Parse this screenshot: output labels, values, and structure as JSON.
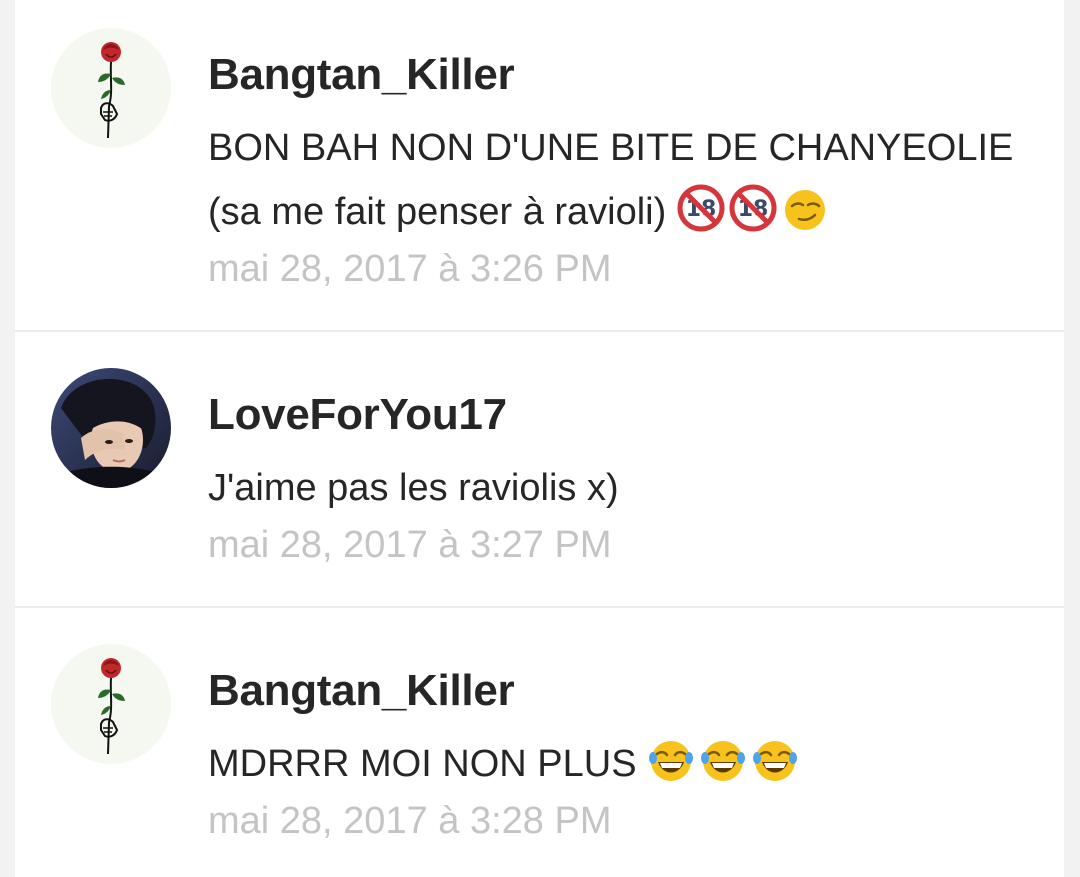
{
  "comments": [
    {
      "username": "Bangtan_Killer",
      "text_line1": "BON BAH NON D'UNE BITE DE CHANYEOLIE",
      "text_line2": "(sa me fait penser à ravioli)",
      "emojis": [
        "no-under-18-icon",
        "no-under-18-icon",
        "smirking-face-icon"
      ],
      "timestamp": "mai 28, 2017 à 3:26 PM",
      "avatar": "rose-hand-avatar"
    },
    {
      "username": "LoveForYou17",
      "text_line1": "J'aime pas les raviolis x)",
      "timestamp": "mai 28, 2017 à 3:27 PM",
      "avatar": "person-photo-avatar"
    },
    {
      "username": "Bangtan_Killer",
      "text_line1": "MDRRR MOI NON PLUS",
      "emojis": [
        "laughing-tears-face-icon",
        "laughing-tears-face-icon",
        "laughing-tears-face-icon"
      ],
      "timestamp": "mai 28, 2017 à 3:28 PM",
      "avatar": "rose-hand-avatar"
    }
  ],
  "colors": {
    "background": "#f2f2f2",
    "card": "#ffffff",
    "username": "#262626",
    "timestamp": "#c4c4c4",
    "divider": "#ececec"
  }
}
